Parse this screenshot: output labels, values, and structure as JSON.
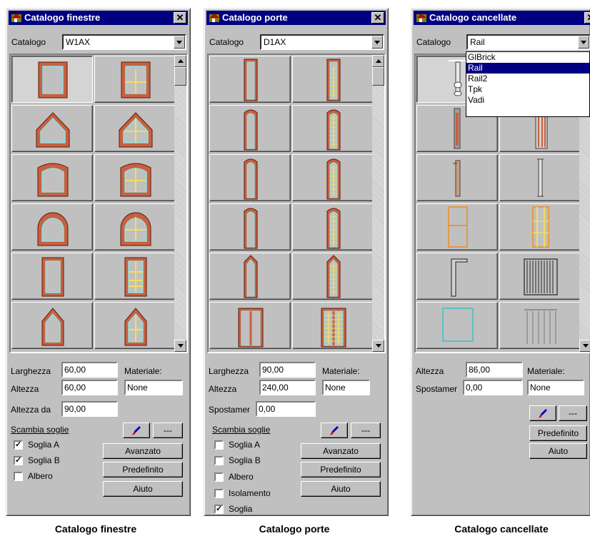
{
  "colors": {
    "title_bg": "#000080",
    "frame": "#b84a2a",
    "frame_fill": "#c86040",
    "glass": "#8fe0e0",
    "mullion": "#f0e060",
    "orange": "#f08a20",
    "cyan": "#40c0c0"
  },
  "windows": [
    {
      "title": "Catalogo finestre",
      "catalog_label": "Catalogo",
      "catalog_value": "W1AX",
      "fields": [
        {
          "label": "Larghezza",
          "value": "60,00"
        },
        {
          "label": "Altezza",
          "value": "60,00"
        },
        {
          "label": "Altezza da",
          "value": "90,00"
        }
      ],
      "material_label": "Materiale:",
      "material_value": "None",
      "swap_label": "Scambia soglie",
      "more_label": "---",
      "checks": [
        {
          "label": "Soglia A",
          "checked": true
        },
        {
          "label": "Soglia B",
          "checked": true
        },
        {
          "label": "Albero",
          "checked": false
        }
      ],
      "buttons": [
        "Avanzato",
        "Predefinito",
        "Aiuto"
      ]
    },
    {
      "title": "Catalogo porte",
      "catalog_label": "Catalogo",
      "catalog_value": "D1AX",
      "fields": [
        {
          "label": "Larghezza",
          "value": "90,00"
        },
        {
          "label": "Altezza",
          "value": "240,00"
        },
        {
          "label": "Spostamer",
          "value": "0,00"
        }
      ],
      "material_label": "Materiale:",
      "material_value": "None",
      "swap_label": "Scambia soglie",
      "more_label": "---",
      "checks": [
        {
          "label": "Soglia A",
          "checked": false
        },
        {
          "label": "Soglia B",
          "checked": false
        },
        {
          "label": "Albero",
          "checked": false
        },
        {
          "label": "Isolamento",
          "checked": false
        },
        {
          "label": "Soglia",
          "checked": true
        }
      ],
      "buttons": [
        "Avanzato",
        "Predefinito",
        "Aiuto"
      ]
    },
    {
      "title": "Catalogo cancellate",
      "catalog_label": "Catalogo",
      "catalog_value": "Rail",
      "fields": [
        {
          "label": "Altezza",
          "value": "86,00"
        },
        {
          "label": "Spostamer",
          "value": "0,00"
        }
      ],
      "material_label": "Materiale:",
      "material_value": "None",
      "more_label": "---",
      "buttons": [
        "Predefinito",
        "Aiuto"
      ],
      "dropdown_options": [
        "GlBrick",
        "Rail",
        "Rail2",
        "Tpk",
        "Vadi"
      ],
      "dropdown_selected": "Rail"
    }
  ],
  "captions": [
    "Catalogo finestre",
    "Catalogo porte",
    "Catalogo cancellate"
  ]
}
